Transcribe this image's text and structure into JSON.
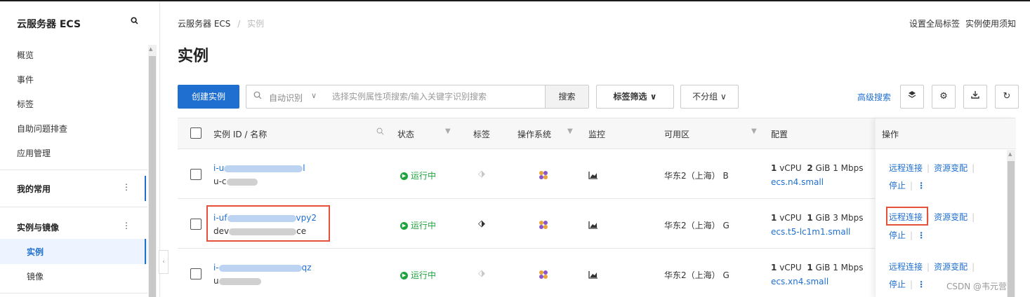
{
  "sidebar": {
    "title": "云服务器 ECS",
    "search_icon": "search-icon",
    "items": [
      "概览",
      "事件",
      "标签",
      "自助问题排查",
      "应用管理"
    ],
    "favorites_label": "我的常用",
    "group_label": "实例与镜像",
    "group_items": [
      "实例",
      "镜像"
    ],
    "active_item": "实例"
  },
  "breadcrumb": {
    "root": "云服务器 ECS",
    "separator": "/",
    "current": "实例"
  },
  "top_links": [
    "设置全局标签",
    "实例使用须知"
  ],
  "page_title": "实例",
  "toolbar": {
    "create_label": "创建实例",
    "search_mode": "自动识别",
    "search_placeholder": "选择实例属性项搜索/输入关键字识别搜索",
    "search_button": "搜索",
    "tag_filter": "标签筛选",
    "group_select": "不分组",
    "advanced_search": "高级搜索",
    "icon_buttons": [
      "layers-icon",
      "settings-icon",
      "download-icon",
      "refresh-icon"
    ]
  },
  "table": {
    "columns": [
      "实例 ID / 名称",
      "状态",
      "标签",
      "操作系统",
      "监控",
      "可用区",
      "配置",
      "操作"
    ],
    "rows": [
      {
        "id_prefix": "i-u",
        "id_suffix": "l",
        "name_prefix": "u-c",
        "name_suffix": "",
        "status": "运行中",
        "tagged": false,
        "zone": "华东2（上海） B",
        "cpu": "1",
        "mem": "2",
        "bandwidth": "1 Mbps",
        "spec": "ecs.n4.small",
        "highlight_id": false,
        "highlight_remote": false
      },
      {
        "id_prefix": "i-uf",
        "id_suffix": "vpy2",
        "name_prefix": "dev",
        "name_suffix": "ce",
        "status": "运行中",
        "tagged": true,
        "zone": "华东2（上海） G",
        "cpu": "1",
        "mem": "1",
        "bandwidth": "3 Mbps",
        "spec": "ecs.t5-lc1m1.small",
        "highlight_id": true,
        "highlight_remote": true
      },
      {
        "id_prefix": "i-",
        "id_suffix": "qz",
        "name_prefix": "u",
        "name_suffix": "",
        "status": "运行中",
        "tagged": false,
        "zone": "华东2（上海） G",
        "cpu": "1",
        "mem": "1",
        "bandwidth": "1 Mbps",
        "spec": "ecs.xn4.small",
        "highlight_id": false,
        "highlight_remote": false
      }
    ],
    "cpu_unit": "vCPU",
    "mem_unit": "GiB",
    "actions": {
      "remote": "远程连接",
      "resize": "资源变配",
      "stop": "停止",
      "more": "⋮"
    }
  },
  "watermark": "CSDN @韦元营",
  "colors": {
    "primary": "#1f6fd1",
    "running": "#1fa33e",
    "highlight": "#e6513c"
  }
}
